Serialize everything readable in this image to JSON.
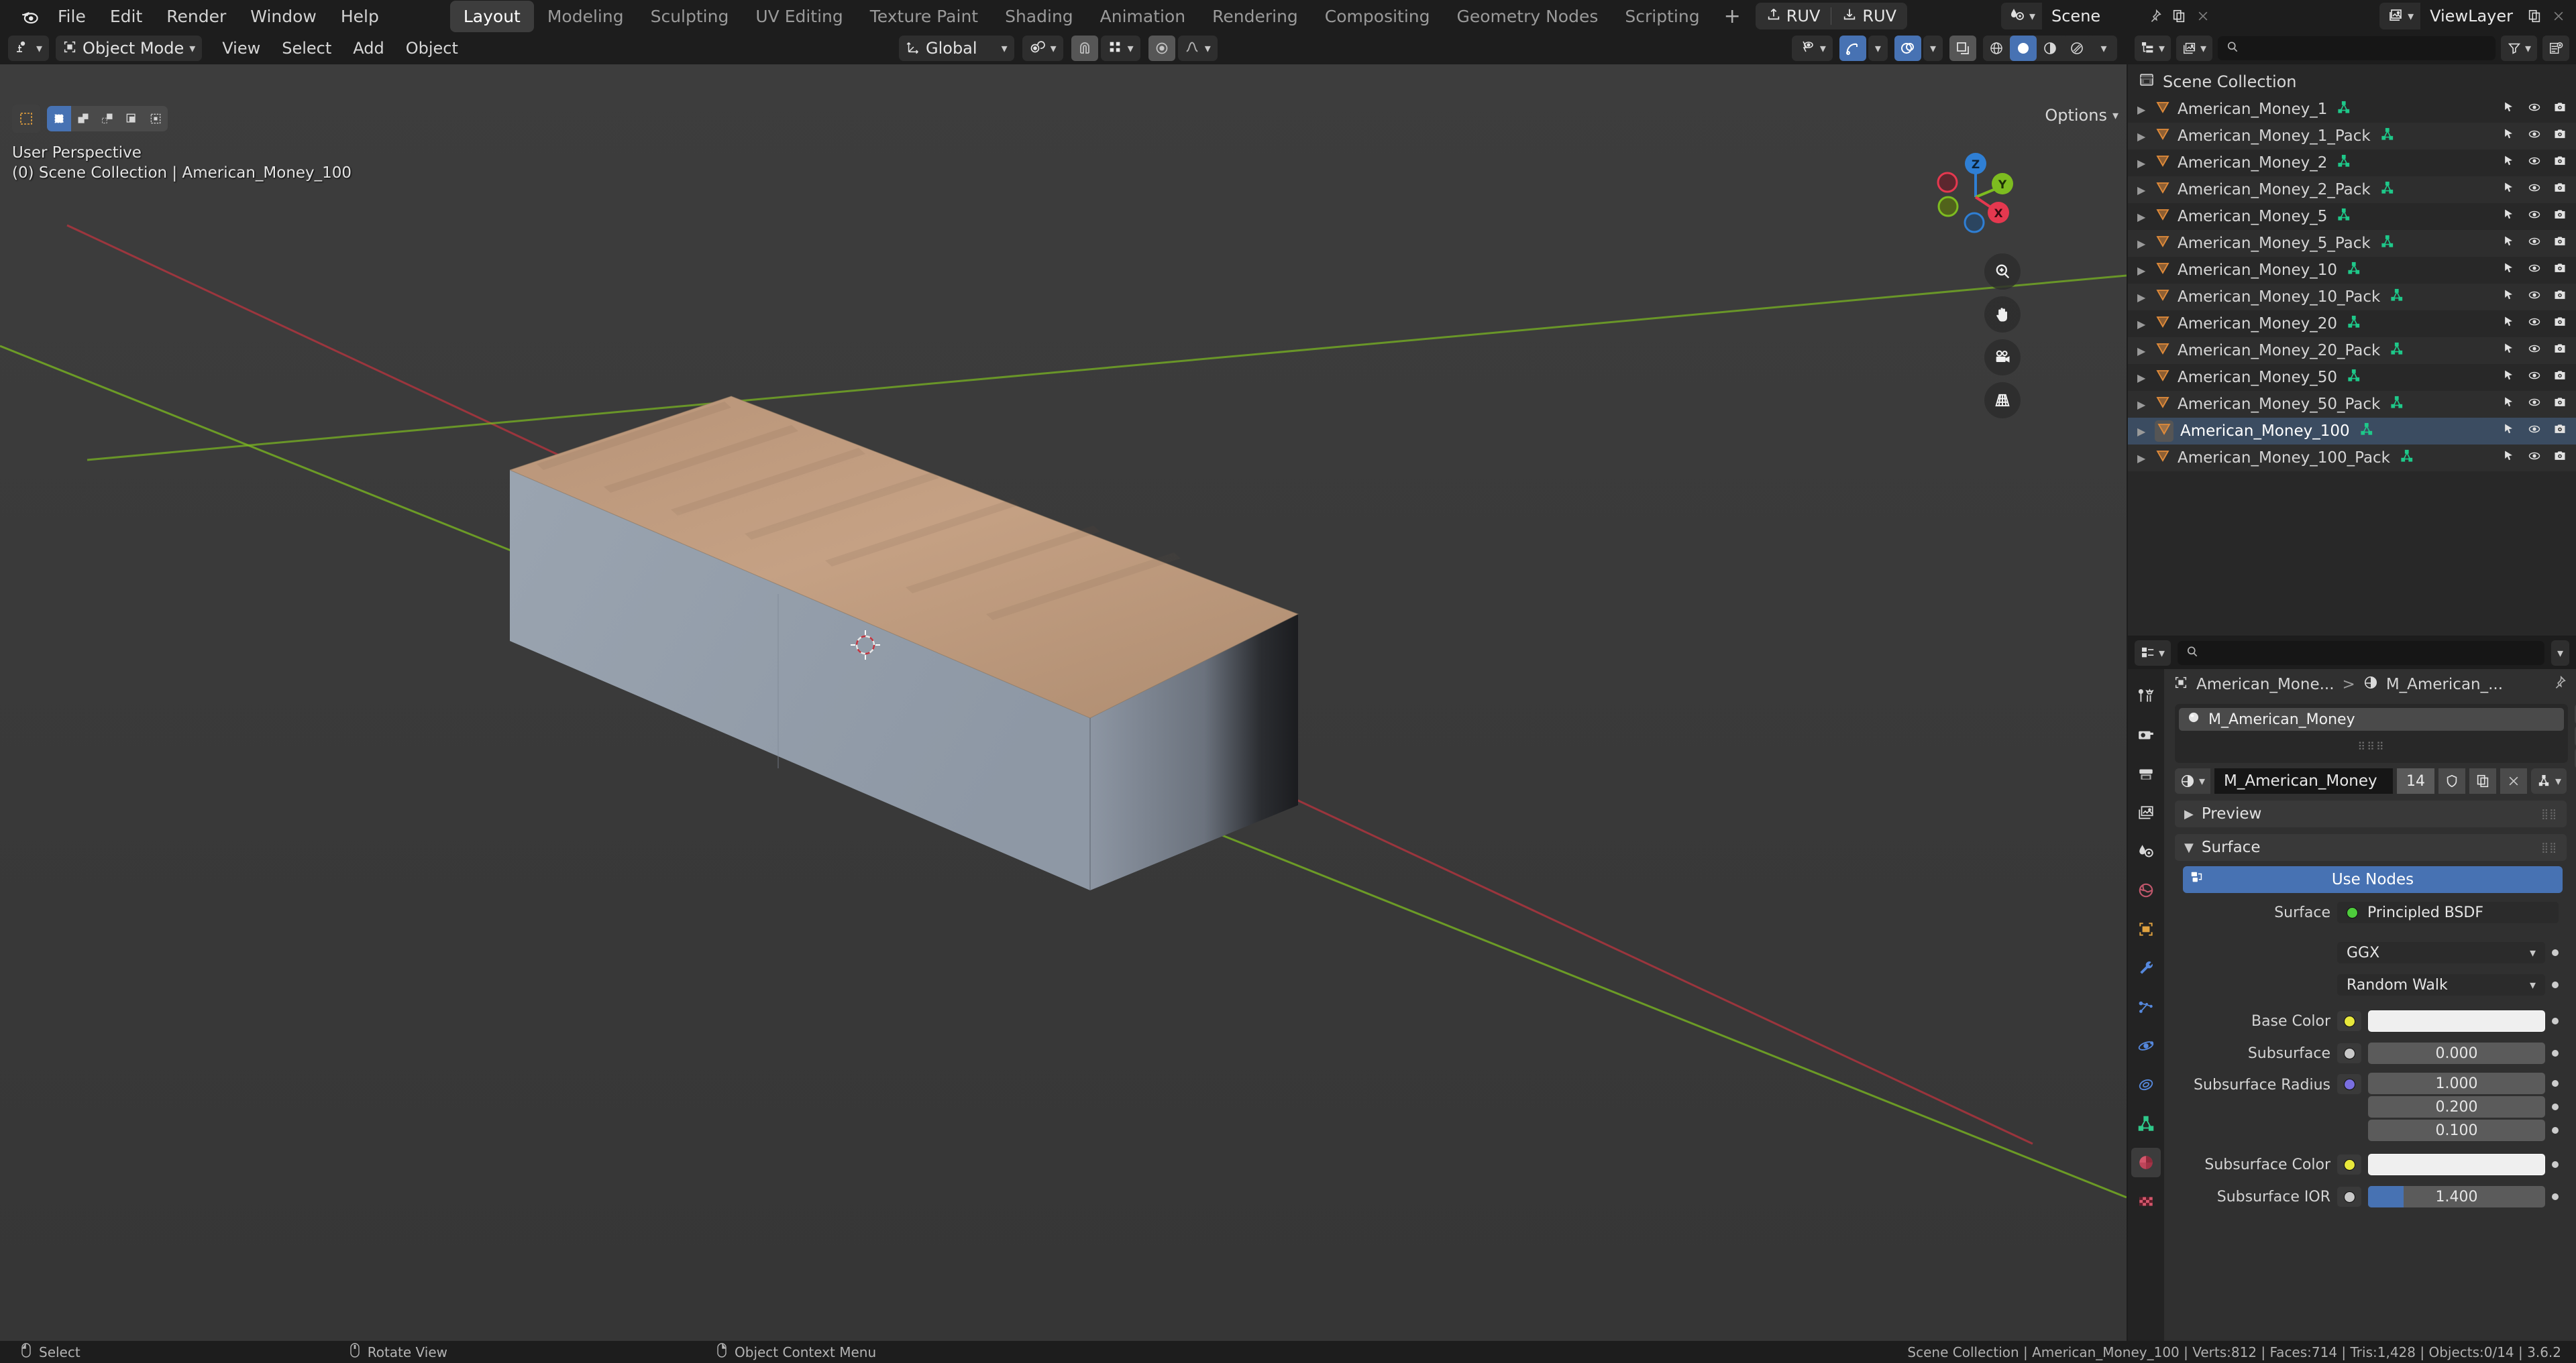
{
  "app": {
    "version": "3.6.2",
    "accent_blue": "#4772b3",
    "bg_dark": "#1d1d1d",
    "viewport_bg": "#393939"
  },
  "topbar": {
    "logo_icon": "blender-logo-icon",
    "menus": [
      "File",
      "Edit",
      "Render",
      "Window",
      "Help"
    ],
    "workspaces": [
      {
        "label": "Layout",
        "active": true
      },
      {
        "label": "Modeling",
        "active": false
      },
      {
        "label": "Sculpting",
        "active": false
      },
      {
        "label": "UV Editing",
        "active": false
      },
      {
        "label": "Texture Paint",
        "active": false
      },
      {
        "label": "Shading",
        "active": false
      },
      {
        "label": "Animation",
        "active": false
      },
      {
        "label": "Rendering",
        "active": false
      },
      {
        "label": "Compositing",
        "active": false
      },
      {
        "label": "Geometry Nodes",
        "active": false
      },
      {
        "label": "Scripting",
        "active": false
      }
    ],
    "add_workspace": "+",
    "addon_buttons": [
      {
        "label": "RUV",
        "icon": "upload-icon"
      },
      {
        "label": "RUV",
        "icon": "download-icon"
      }
    ],
    "scene": {
      "icon": "scene-icon",
      "name": "Scene",
      "pin_icon": "pin-icon",
      "copy_icon": "copy-icon",
      "close_icon": "close-icon"
    },
    "view_layer": {
      "icon": "view-layer-icon",
      "name": "ViewLayer",
      "copy_icon": "copy-icon",
      "close_icon": "close-icon"
    }
  },
  "viewport": {
    "header": {
      "editor_type_icon": "editor-type-3dview-icon",
      "mode": "Object Mode",
      "mode_icon": "object-mode-icon",
      "menus": [
        "View",
        "Select",
        "Add",
        "Object"
      ],
      "transform_orientation": "Global",
      "transform_icon": "orientation-icon",
      "pivot_icon": "pivot-point-icon",
      "snap_magnet_icon": "magnet-icon",
      "snap_to_icon": "snap-increment-icon",
      "proportional_icon": "proportional-edit-icon",
      "falloff_icon": "smooth-falloff-icon",
      "visibility_icon": "object-visibility-icon",
      "gizmo_icon": "gizmo-icon",
      "overlays_icon": "overlays-icon",
      "xray_icon": "xray-icon",
      "shading_modes": [
        {
          "icon": "wireframe-icon",
          "active": false
        },
        {
          "icon": "solid-shading-icon",
          "active": true
        },
        {
          "icon": "material-preview-icon",
          "active": false
        },
        {
          "icon": "rendered-shading-icon",
          "active": false
        }
      ]
    },
    "toolbar_icons": [
      "tweak-tool-icon",
      "cursor-tool-icon",
      "move-tool-icon",
      "rotate-tool-icon",
      "scale-tool-icon",
      "transform-tool-icon",
      "annotate-tool-icon",
      "measure-tool-icon",
      "add-cube-tool-icon"
    ],
    "select_modes": [
      {
        "icon": "select-box-icon",
        "active": true
      },
      {
        "icon": "select-extend-icon",
        "active": false
      },
      {
        "icon": "select-subtract-icon",
        "active": false
      },
      {
        "icon": "select-invert-icon",
        "active": false
      },
      {
        "icon": "select-intersect-icon",
        "active": false
      }
    ],
    "options_label": "Options",
    "overlay_line_1": "User Perspective",
    "overlay_line_2": "(0) Scene Collection | American_Money_100",
    "gizmo_axes": [
      {
        "label": "Z",
        "color": "#2f7fd4",
        "filled": true
      },
      {
        "label": "Y",
        "color": "#7dbc20",
        "filled": true
      },
      {
        "label": "X",
        "color": "#e5384f",
        "filled": true
      },
      {
        "label": "",
        "color": "#e5384f",
        "filled": false
      },
      {
        "label": "",
        "color": "#7dbc20",
        "filled": false
      },
      {
        "label": "",
        "color": "#2f7fd4",
        "filled": false
      }
    ],
    "nav_buttons": [
      {
        "icon": "zoom-icon"
      },
      {
        "icon": "hand-pan-icon"
      },
      {
        "icon": "camera-view-icon"
      },
      {
        "icon": "toggle-perspective-icon"
      }
    ]
  },
  "outliner": {
    "display_mode_icon": "outliner-display-mode-icon",
    "filter_id_icon": "filter-id-icon",
    "search_placeholder": "",
    "search_value": "",
    "filter_icon": "funnel-filter-icon",
    "new_collection_icon": "new-collection-icon",
    "root": {
      "label": "Scene Collection",
      "icon": "collection-icon"
    },
    "items": [
      {
        "label": "American_Money_1",
        "icon": "mesh-object-icon",
        "selected": false
      },
      {
        "label": "American_Money_1_Pack",
        "icon": "mesh-object-icon",
        "selected": false
      },
      {
        "label": "American_Money_2",
        "icon": "mesh-object-icon",
        "selected": false
      },
      {
        "label": "American_Money_2_Pack",
        "icon": "mesh-object-icon",
        "selected": false
      },
      {
        "label": "American_Money_5",
        "icon": "mesh-object-icon",
        "selected": false
      },
      {
        "label": "American_Money_5_Pack",
        "icon": "mesh-object-icon",
        "selected": false
      },
      {
        "label": "American_Money_10",
        "icon": "mesh-object-icon",
        "selected": false
      },
      {
        "label": "American_Money_10_Pack",
        "icon": "mesh-object-icon",
        "selected": false
      },
      {
        "label": "American_Money_20",
        "icon": "mesh-object-icon",
        "selected": false
      },
      {
        "label": "American_Money_20_Pack",
        "icon": "mesh-object-icon",
        "selected": false
      },
      {
        "label": "American_Money_50",
        "icon": "mesh-object-icon",
        "selected": false
      },
      {
        "label": "American_Money_50_Pack",
        "icon": "mesh-object-icon",
        "selected": false
      },
      {
        "label": "American_Money_100",
        "icon": "mesh-object-icon",
        "selected": true
      },
      {
        "label": "American_Money_100_Pack",
        "icon": "mesh-object-icon",
        "selected": false
      }
    ],
    "row_icons": {
      "expand": "disclosure-triangle-icon",
      "data": "mesh-data-icon",
      "selectable": "cursor-selectable-icon",
      "visibility": "eye-icon",
      "render": "camera-render-icon"
    }
  },
  "properties": {
    "editor_icon": "properties-editor-icon",
    "search_placeholder": "",
    "tabs": [
      {
        "icon": "tool-icon",
        "active": false
      },
      {
        "icon": "render-properties-icon",
        "active": false
      },
      {
        "icon": "output-properties-icon",
        "active": false
      },
      {
        "icon": "view-layer-properties-icon",
        "active": false
      },
      {
        "icon": "scene-properties-icon",
        "active": false
      },
      {
        "icon": "world-properties-icon",
        "active": false
      },
      {
        "icon": "object-properties-icon",
        "active": false
      },
      {
        "icon": "modifier-properties-icon",
        "active": false
      },
      {
        "icon": "particle-properties-icon",
        "active": false
      },
      {
        "icon": "physics-properties-icon",
        "active": false
      },
      {
        "icon": "constraint-properties-icon",
        "active": false
      },
      {
        "icon": "data-properties-icon",
        "active": false
      },
      {
        "icon": "material-properties-icon",
        "active": true
      },
      {
        "icon": "texture-properties-icon",
        "active": false
      }
    ],
    "breadcrumb": {
      "object_icon": "object-icon",
      "object": "American_Mone...",
      "separator": ">",
      "material_icon": "material-icon",
      "material": "M_American_...",
      "pin_icon": "pin-icon"
    },
    "material_slot": {
      "name": "M_American_Money",
      "sphere_icon": "material-sphere-icon",
      "add_label": "+",
      "remove_label": "−",
      "menu_icon": "dropdown-icon"
    },
    "material_datablock": {
      "browse_icon": "material-browse-icon",
      "name": "M_American_Money",
      "users": "14",
      "shield_icon": "fake-user-shield-icon",
      "copy_icon": "new-material-icon",
      "unlink_icon": "unlink-x-icon",
      "slot_icon": "mesh-data-icon"
    },
    "panels": [
      {
        "label": "Preview",
        "open": false
      },
      {
        "label": "Surface",
        "open": true
      }
    ],
    "use_nodes_label": "Use Nodes",
    "use_nodes_icon": "nodetree-icon",
    "surface_rows": [
      {
        "label": "Surface",
        "value": "Principled BSDF",
        "type": "node",
        "socket_color": "#4ecc3c"
      },
      {
        "label": "",
        "value": "GGX",
        "type": "dropdown"
      },
      {
        "label": "",
        "value": "Random Walk",
        "type": "dropdown"
      },
      {
        "label": "Base Color",
        "value": "",
        "type": "color",
        "color": "#efefef",
        "socket_color": "#e8e83c"
      },
      {
        "label": "Subsurface",
        "value": "0.000",
        "type": "number",
        "socket_color": "#c8c8c8"
      },
      {
        "label": "Subsurface Radius",
        "values": [
          "1.000",
          "0.200",
          "0.100"
        ],
        "type": "vector",
        "socket_color": "#7a6fe0"
      },
      {
        "label": "Subsurface Color",
        "value": "",
        "type": "color",
        "color": "#efefef",
        "socket_color": "#e8e83c"
      },
      {
        "label": "Subsurface IOR",
        "value": "1.400",
        "type": "slider",
        "socket_color": "#c8c8c8",
        "fill_color": "#4772b3"
      }
    ]
  },
  "statusbar": {
    "hints": [
      {
        "icon": "mouse-left-icon",
        "label": "Select"
      },
      {
        "icon": "mouse-middle-icon",
        "label": "Rotate View"
      },
      {
        "icon": "mouse-right-icon",
        "label": "Object Context Menu"
      }
    ],
    "scene_stats": "Scene Collection | American_Money_100 | Verts:812 | Faces:714 | Tris:1,428 | Objects:0/14 | 3.6.2"
  }
}
